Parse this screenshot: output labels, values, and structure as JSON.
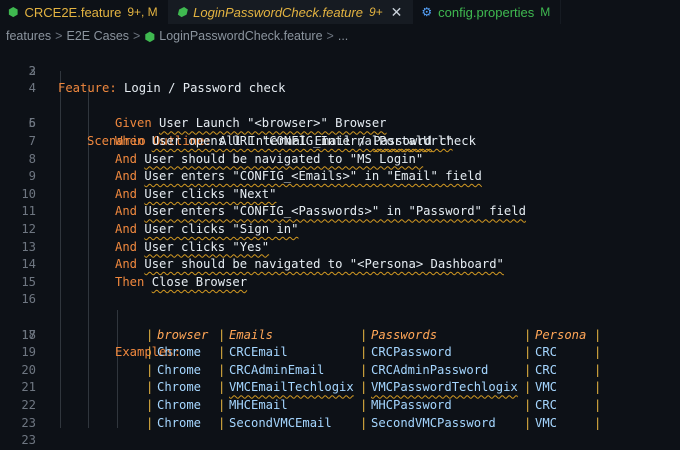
{
  "tabs": [
    {
      "label": "CRCE2E.feature",
      "status": "9+, M",
      "icon": "gherkin-icon"
    },
    {
      "label": "LoginPasswordCheck.feature",
      "status": "9+",
      "icon": "gherkin-icon",
      "close": "✕"
    },
    {
      "label": "config.properties",
      "status": "M",
      "icon": "gear-icon"
    }
  ],
  "breadcrumb": {
    "items": [
      "features",
      "E2E Cases",
      "LoginPasswordCheck.feature",
      "..."
    ],
    "sep": ">"
  },
  "lines": [
    {
      "n": "2",
      "feature_kw": "Feature:",
      "feature_text": " Login / Password check"
    },
    {
      "n": "3"
    },
    {
      "n": "4"
    },
    {
      "n": "5",
      "scenario_kw": "Scenario Outline:",
      "scenario_text": " All Internal Email / ",
      "scenario_squig": "Passowrd",
      "scenario_tail": " check"
    },
    {
      "n": "6",
      "kw": "Given",
      "text": "User Launch \"<browser>\" Browser"
    },
    {
      "n": "7",
      "kw": "When",
      "text": "User opens URL \"CONFIG_InternalPortalUrl\""
    },
    {
      "n": "8",
      "kw": "And",
      "text": "User should be navigated to \"MS Login\""
    },
    {
      "n": "9",
      "kw": "And",
      "text": "User enters \"CONFIG_<Emails>\" in \"Email\" field"
    },
    {
      "n": "10",
      "kw": "And",
      "text": "User clicks \"Next\""
    },
    {
      "n": "11",
      "kw": "And",
      "text": "User enters \"CONFIG_<Passwords>\" in \"Password\" field"
    },
    {
      "n": "12",
      "kw": "And",
      "text": "User clicks \"Sign in\""
    },
    {
      "n": "13",
      "kw": "And",
      "text": "User clicks \"Yes\""
    },
    {
      "n": "14",
      "kw": "And",
      "text": "User should be navigated to \"<Persona> Dashboard\""
    },
    {
      "n": "15",
      "kw": "Then",
      "text": "Close Browser"
    },
    {
      "n": "16"
    },
    {
      "n": "17",
      "examples": "Examples:"
    },
    {
      "n": "18"
    },
    {
      "n": "19"
    },
    {
      "n": "20"
    },
    {
      "n": "21"
    },
    {
      "n": "22"
    },
    {
      "n": "23"
    }
  ],
  "table": {
    "headers": [
      "browser",
      "Emails",
      "Passwords",
      "Persona"
    ],
    "rows": [
      [
        "Chrome",
        "CRCEmail",
        "CRCPassword",
        "CRC"
      ],
      [
        "Chrome",
        "CRCAdminEmail",
        "CRCAdminPassword",
        "CRC"
      ],
      [
        "Chrome",
        "VMCEmailTechlogix",
        "VMCPasswordTechlogix",
        "VMC"
      ],
      [
        "Chrome",
        "MHCEmail",
        "MHCPassword",
        "CRC"
      ],
      [
        "Chrome",
        "SecondVMCEmail",
        "SecondVMCPassword",
        "VMC"
      ]
    ]
  },
  "colors": {
    "background": "#0d1117",
    "keyword": "#f0883e",
    "string": "#a5d6ff",
    "modified": "#e3b341",
    "added": "#3fb950"
  }
}
